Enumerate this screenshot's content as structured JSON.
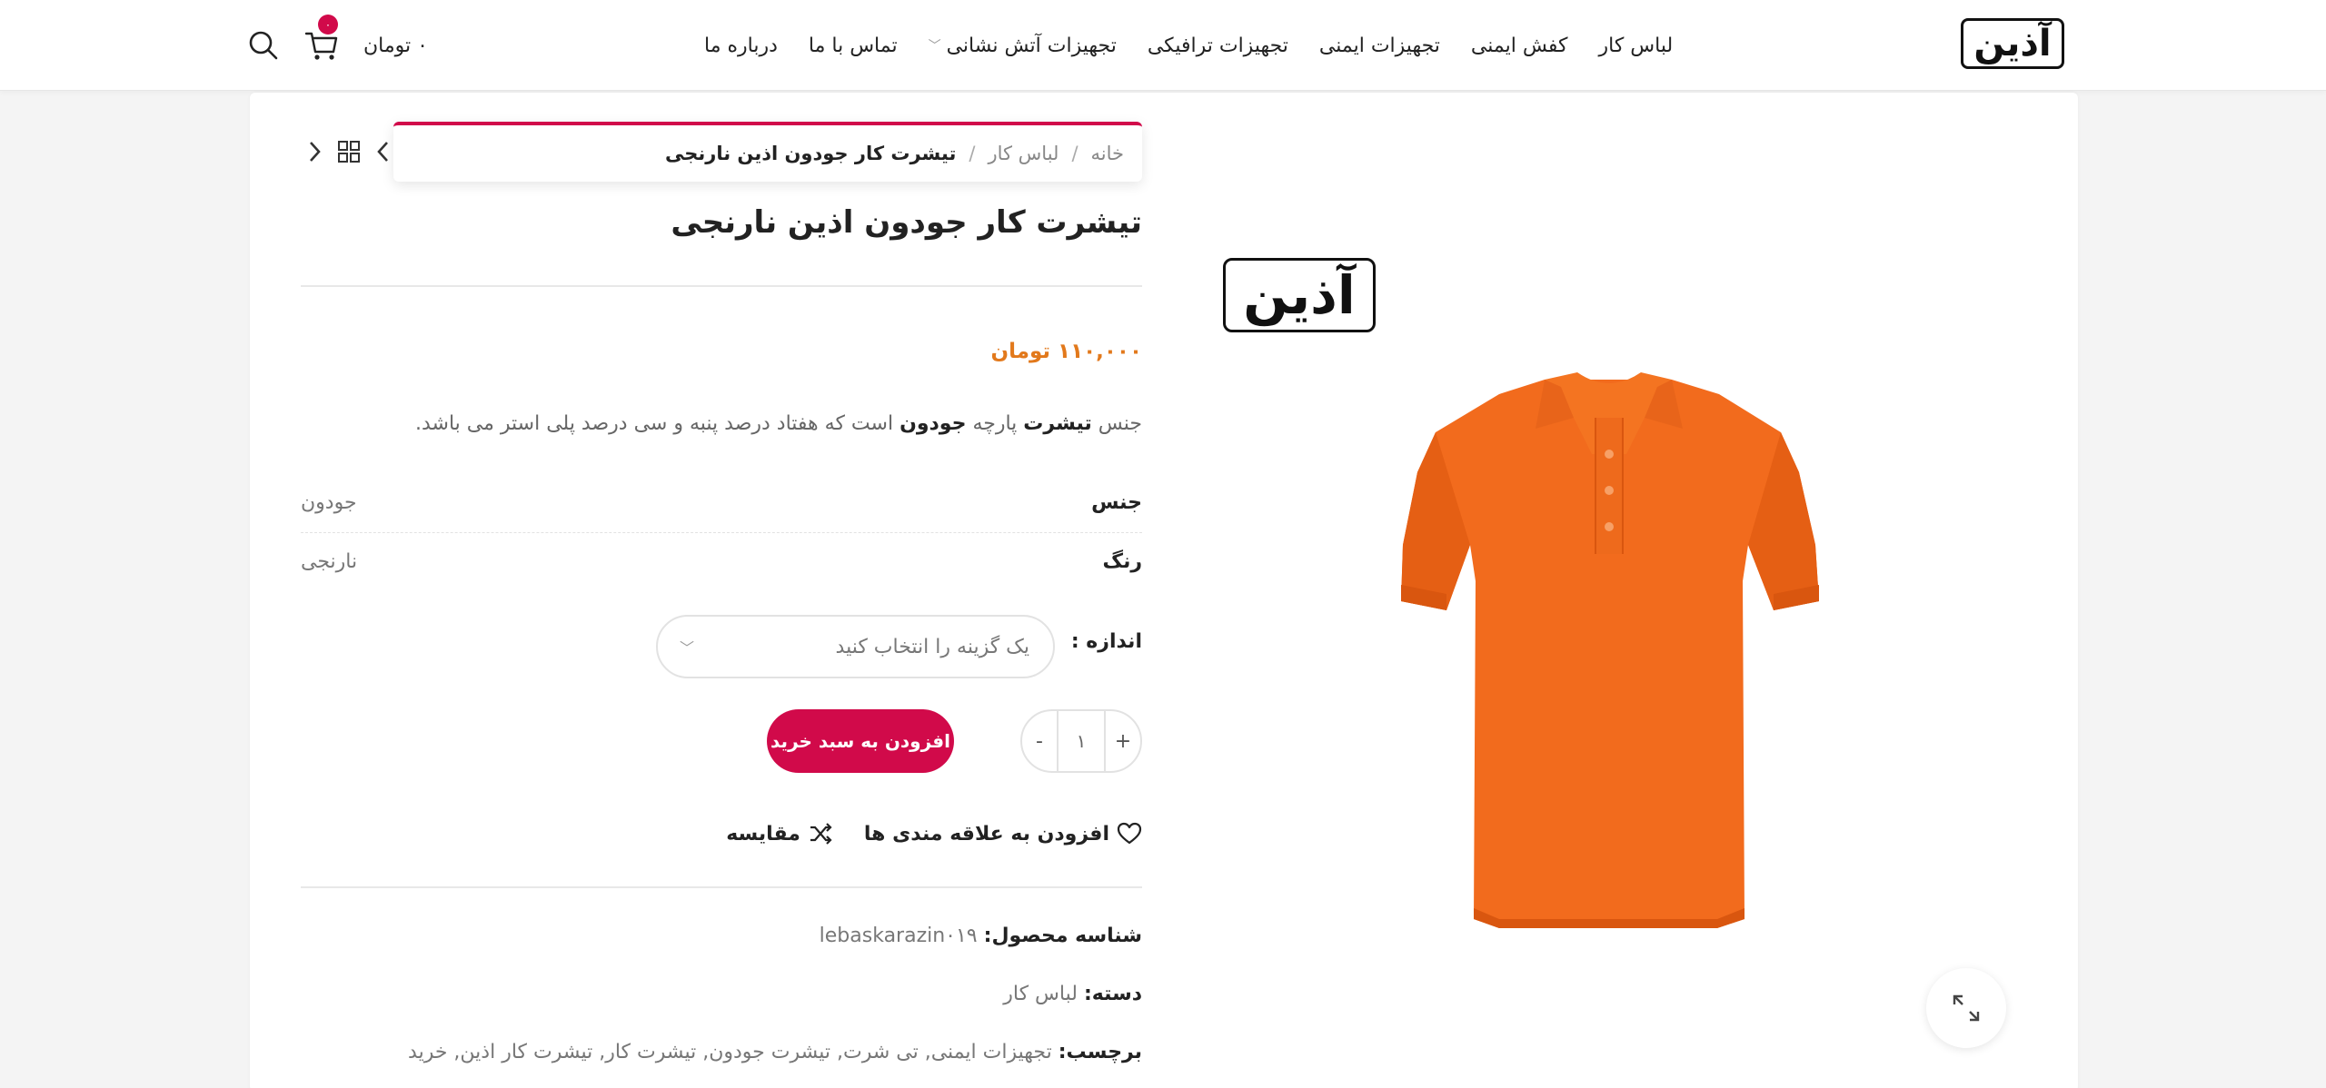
{
  "colors": {
    "accent": "#d10a4a",
    "price": "#e2791c",
    "shirt": "#f26b1d"
  },
  "header": {
    "logo_text": "آذین",
    "nav": [
      {
        "label": "لباس کار"
      },
      {
        "label": "کفش ایمنی"
      },
      {
        "label": "تجهیزات ایمنی"
      },
      {
        "label": "تجهیزات ترافیکی"
      },
      {
        "label": "تجهیزات آتش نشانی",
        "has_dropdown": true
      },
      {
        "label": "تماس با ما"
      },
      {
        "label": "درباره ما"
      }
    ],
    "cart_count": "۰",
    "cart_total": "۰ تومان",
    "icons": [
      "search-icon",
      "cart-icon",
      "chevron-down-icon"
    ]
  },
  "breadcrumb": {
    "items": [
      "خانه",
      "لباس کار"
    ],
    "current": "تیشرت کار جودون اذین نارنجی",
    "separator": "/"
  },
  "product": {
    "title": "تیشرت کار جودون اذین نارنجی",
    "price": "۱۱۰,۰۰۰ تومان",
    "description": {
      "p1": "جنس ",
      "b1": "تیشرت",
      "p2": " پارچه ",
      "b2": "جودون",
      "p3": " است که هفتاد درصد پنبه و سی درصد پلی استر می باشد."
    },
    "attributes": [
      {
        "key": "جنس",
        "value": "جودون"
      },
      {
        "key": "رنگ",
        "value": "نارنجی"
      }
    ],
    "size_label": "اندازه :",
    "size_placeholder": "یک گزینه را انتخاب کنید",
    "quantity": "۱",
    "qty_minus": "-",
    "qty_plus": "+",
    "add_to_cart": "افزودن به سبد خرید",
    "compare": "مقایسه",
    "wishlist": "افزودن به علاقه مندی ها",
    "sku_label": "شناسه محصول:",
    "sku": "lebaskarazin۰۱۹",
    "category_label": "دسته:",
    "category": "لباس کار",
    "tags_label": "برچسب:",
    "tags": "تجهیزات ایمنی, تی شرت, تیشرت جودون, تیشرت کار, تیشرت کار اذین, خرید",
    "image_logo_text": "آذین"
  }
}
